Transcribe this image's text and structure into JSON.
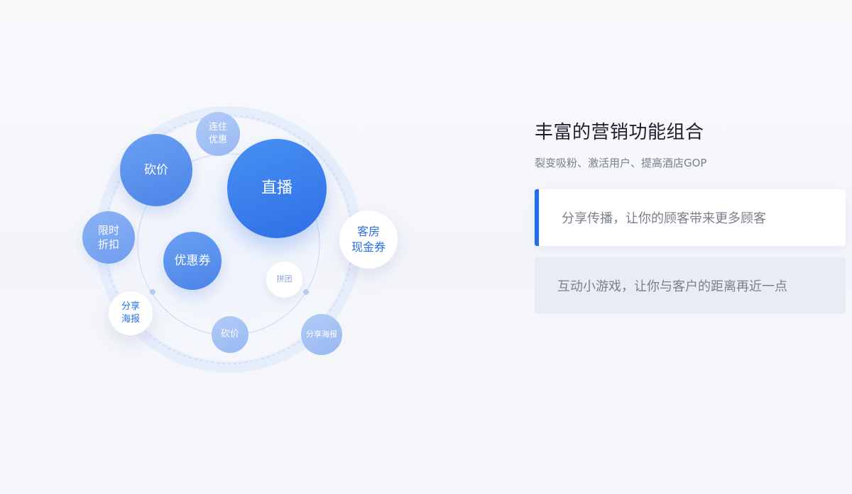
{
  "bubbles": {
    "live": "直播",
    "bargain_large": "砍价",
    "stay_discount": [
      "连住",
      "优惠"
    ],
    "limited_discount": [
      "限时",
      "折扣"
    ],
    "coupon": "优惠券",
    "room_cash_coupon": [
      "客房",
      "现金券"
    ],
    "group_buy": "拼团",
    "share_poster": [
      "分享",
      "海报"
    ],
    "bargain_small": "砍价",
    "share_poster_small": "分享海报"
  },
  "section": {
    "title": "丰富的营销功能组合",
    "subtitle": "裂变吸粉、激活用户、提高酒店GOP",
    "features": [
      {
        "label": "分享传播，让你的顾客带来更多顾客",
        "active": true
      },
      {
        "label": "互动小游戏，让你与客户的距离再近一点",
        "active": false
      }
    ]
  },
  "colors": {
    "accent": "#1f6ff0",
    "bubble_primary": "#3a7cec",
    "bubble_white_text": "#2a6ee5",
    "inactive_card": "#e8ecf4"
  }
}
